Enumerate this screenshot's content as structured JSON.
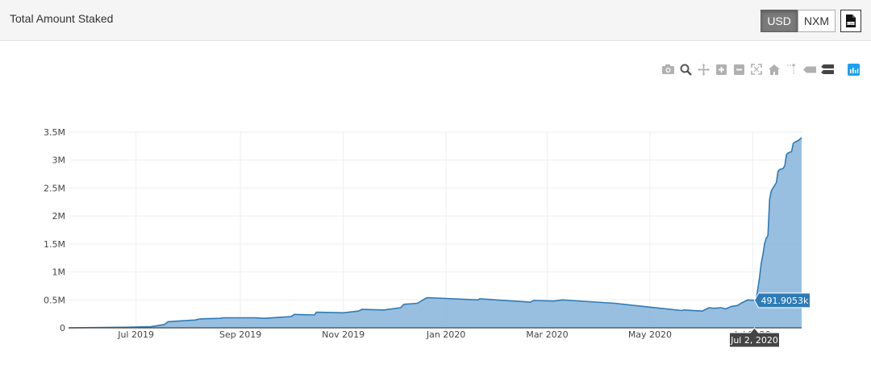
{
  "header": {
    "title": "Total Amount Staked",
    "currency_options": [
      "USD",
      "NXM"
    ],
    "selected_currency": "USD",
    "export_icon": "csv-file-icon"
  },
  "modebar": {
    "icons": [
      "camera-icon",
      "zoom-icon",
      "pan-icon",
      "zoom-in-icon",
      "zoom-out-icon",
      "autoscale-icon",
      "reset-axes-icon",
      "spike-lines-icon",
      "hover-closest-icon",
      "hover-compare-icon",
      "plotly-logo-icon"
    ]
  },
  "colors": {
    "line": "#2e7bb6",
    "fill": "#8db8dc",
    "hover_label_bg": "#2e7bb6",
    "axis_label_bg": "#444444"
  },
  "hover": {
    "x_label": "Jul 2, 2020",
    "y_label": "491.9053k"
  },
  "chart_data": {
    "type": "area",
    "title": "",
    "xlabel": "",
    "ylabel": "",
    "x_ticks": [
      "Jul 2019",
      "Sep 2019",
      "Nov 2019",
      "Jan 2020",
      "Mar 2020",
      "May 2020",
      "Jul 2020"
    ],
    "y_ticks": [
      "0",
      "0.5M",
      "1M",
      "1.5M",
      "2M",
      "2.5M",
      "3M",
      "3.5M"
    ],
    "xlim": [
      "2019-05-22",
      "2020-07-30"
    ],
    "ylim": [
      0,
      3500000
    ],
    "grid": true,
    "series": [
      {
        "x": [
          "2019-05-22",
          "2019-06-25",
          "2019-07-10",
          "2019-07-18",
          "2019-07-20",
          "2019-07-25",
          "2019-08-05",
          "2019-08-08",
          "2019-08-20",
          "2019-08-22",
          "2019-09-10",
          "2019-09-15",
          "2019-09-25",
          "2019-10-01",
          "2019-10-03",
          "2019-10-15",
          "2019-10-16",
          "2019-11-01",
          "2019-11-10",
          "2019-11-12",
          "2019-11-25",
          "2019-12-05",
          "2019-12-07",
          "2019-12-15",
          "2019-12-20",
          "2019-12-21",
          "2020-01-20",
          "2020-01-21",
          "2020-02-20",
          "2020-02-22",
          "2020-03-05",
          "2020-03-10",
          "2020-03-15",
          "2020-04-10",
          "2020-05-01",
          "2020-05-20",
          "2020-05-21",
          "2020-06-01",
          "2020-06-05",
          "2020-06-08",
          "2020-06-12",
          "2020-06-15",
          "2020-06-18",
          "2020-06-22",
          "2020-06-24",
          "2020-06-26",
          "2020-06-28",
          "2020-07-02",
          "2020-07-03",
          "2020-07-04",
          "2020-07-05",
          "2020-07-06",
          "2020-07-07",
          "2020-07-08",
          "2020-07-09",
          "2020-07-10",
          "2020-07-11",
          "2020-07-12",
          "2020-07-13",
          "2020-07-14",
          "2020-07-15",
          "2020-07-16",
          "2020-07-17",
          "2020-07-18",
          "2020-07-19",
          "2020-07-20",
          "2020-07-21",
          "2020-07-22",
          "2020-07-24",
          "2020-07-25",
          "2020-07-26",
          "2020-07-28",
          "2020-07-30"
        ],
        "values": [
          0,
          10000,
          20000,
          60000,
          110000,
          120000,
          140000,
          160000,
          170000,
          180000,
          180000,
          170000,
          190000,
          200000,
          240000,
          230000,
          280000,
          270000,
          300000,
          330000,
          320000,
          360000,
          420000,
          440000,
          530000,
          540000,
          500000,
          520000,
          460000,
          490000,
          480000,
          500000,
          490000,
          440000,
          370000,
          310000,
          320000,
          300000,
          360000,
          350000,
          360000,
          340000,
          380000,
          400000,
          440000,
          470000,
          500000,
          491905,
          520000,
          700000,
          900000,
          1150000,
          1300000,
          1500000,
          1600000,
          1650000,
          2300000,
          2450000,
          2500000,
          2550000,
          2600000,
          2800000,
          2830000,
          2840000,
          2850000,
          2900000,
          3100000,
          3130000,
          3150000,
          3300000,
          3320000,
          3350000,
          3400000
        ]
      }
    ]
  }
}
